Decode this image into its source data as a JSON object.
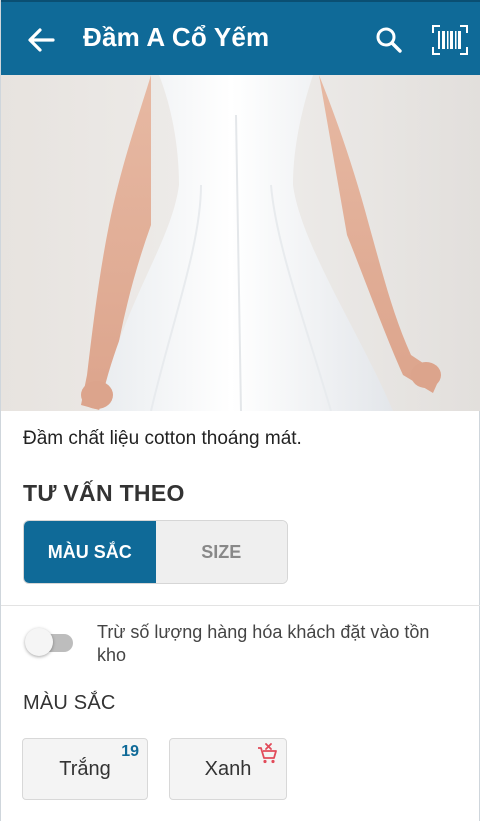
{
  "appbar": {
    "title": "Đầm A Cổ Yếm",
    "color": "#0f6a98"
  },
  "product": {
    "image_alt": "white dress photo",
    "description": "Đầm chất liệu cotton thoáng mát."
  },
  "advice": {
    "title": "TƯ VẤN THEO",
    "options": [
      {
        "label": "MÀU SẮC",
        "active": true
      },
      {
        "label": "SIZE",
        "active": false
      }
    ]
  },
  "toggle": {
    "label": "Trừ số lượng hàng hóa khách đặt vào tồn kho",
    "on": false
  },
  "colors": {
    "title": "MÀU SẮC",
    "items": [
      {
        "label": "Trắng",
        "badge": "19",
        "icon": ""
      },
      {
        "label": "Xanh",
        "badge": "",
        "icon": "out-of-stock-cart-icon"
      }
    ]
  }
}
